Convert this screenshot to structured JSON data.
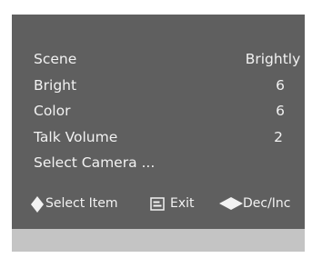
{
  "colors": {
    "panel": "#5f5f5f",
    "footer_band": "#c4c4c4",
    "text": "#f2f2f2"
  },
  "menu": {
    "items": [
      {
        "label": "Scene",
        "value": "Brightly"
      },
      {
        "label": "Bright",
        "value": "6"
      },
      {
        "label": "Color",
        "value": "6"
      },
      {
        "label": "Talk Volume",
        "value": "2"
      },
      {
        "label": "Select Camera ...",
        "value": ""
      }
    ]
  },
  "help": {
    "select_icon": "up-down-diamond-icon",
    "select_label": "Select Item",
    "exit_icon": "exit-box-icon",
    "exit_label": "Exit",
    "adjust_icon": "left-right-diamond-icon",
    "adjust_label": "Dec/Inc"
  }
}
